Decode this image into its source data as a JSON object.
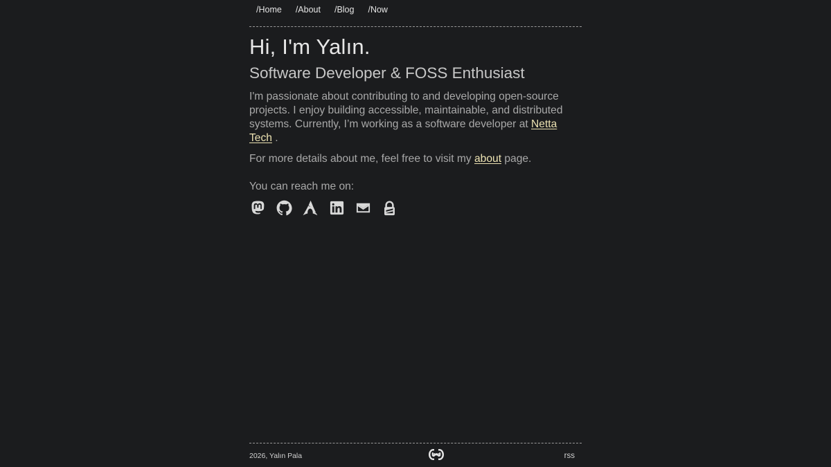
{
  "nav": {
    "items": [
      {
        "label": "/Home"
      },
      {
        "label": "/About"
      },
      {
        "label": "/Blog"
      },
      {
        "label": "/Now"
      }
    ]
  },
  "hero": {
    "title": "Hi, I'm Yalın.",
    "subtitle": "Software Developer & FOSS Enthusiast",
    "intro_text": "I'm passionate about contributing to and developing open-source projects. I enjoy building accessible, maintainable, and distributed systems. Currently, I’m working as a software developer at ",
    "company_link": "Netta Tech",
    "intro_end": " .",
    "more_prefix": "For more details about me, feel free to visit my ",
    "about_link": "about",
    "more_suffix": " page.",
    "reach_label": "You can reach me on:"
  },
  "socials": [
    {
      "icon": "mastodon-icon"
    },
    {
      "icon": "github-icon"
    },
    {
      "icon": "arch-icon"
    },
    {
      "icon": "linkedin-icon"
    },
    {
      "icon": "email-icon"
    },
    {
      "icon": "keyoxide-icon"
    }
  ],
  "footer": {
    "copyright": "2026, Yalın Pala",
    "logo_icon": "webring-icon",
    "rss_label": "rss"
  },
  "colors": {
    "background": "#1b1c1e",
    "link_accent": "#ede3b3",
    "divider": "#9a9a9a"
  }
}
